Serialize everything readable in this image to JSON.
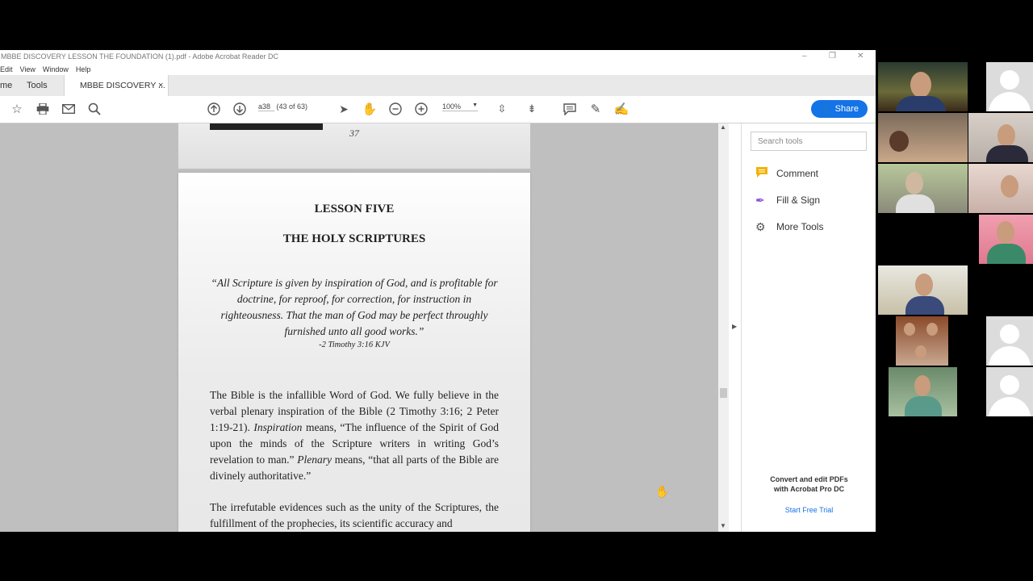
{
  "window": {
    "title": "MBBE DISCOVERY LESSON THE FOUNDATION (1).pdf - Adobe Acrobat Reader DC",
    "controls": {
      "minimize": "–",
      "restore": "❐",
      "close": "✕"
    }
  },
  "menu": [
    "Edit",
    "View",
    "Window",
    "Help"
  ],
  "tabs": {
    "home": "me",
    "tools": "Tools",
    "doc": "MBBE DISCOVERY ...",
    "close": "×"
  },
  "toolbar": {
    "page_input": "a38",
    "page_count": "(43 of 63)",
    "zoom": "100%",
    "share_label": "Share"
  },
  "document": {
    "prev_page_number": "37",
    "lesson_title": "LESSON FIVE",
    "lesson_subtitle": "THE HOLY SCRIPTURES",
    "quote": "“All Scripture is given by inspiration of God, and is profitable for doctrine, for reproof, for correction, for instruction in righteousness. That the man of God may be perfect throughly furnished unto all good works.”",
    "quote_ref": "-2 Timothy 3:16 KJV",
    "para1_a": "The Bible is the infallible Word of God. We fully believe in the verbal plenary inspiration of the Bible (2 Timothy 3:16; 2 Peter 1:19-21). ",
    "para1_b": "Inspiration",
    "para1_c": " means, “The influence of the Spirit of God upon the minds of the Scripture writers in writing God’s revelation to man.” ",
    "para1_d": "Plenary",
    "para1_e": " means, “that all parts of the Bible are divinely authoritative.”",
    "para2": "The irrefutable evidences such as the unity of the Scriptures, the fulfillment of the prophecies, its scientific accuracy and"
  },
  "right_pane": {
    "search_placeholder": "Search tools",
    "tools": [
      "Comment",
      "Fill & Sign",
      "More Tools"
    ],
    "promo_line1": "Convert and edit PDFs",
    "promo_line2": "with Acrobat Pro DC",
    "trial_link": "Start Free Trial"
  },
  "colors": {
    "accent": "#1473e6",
    "comment_icon": "#f3b200",
    "fillsign_icon": "#8a4fd6"
  }
}
